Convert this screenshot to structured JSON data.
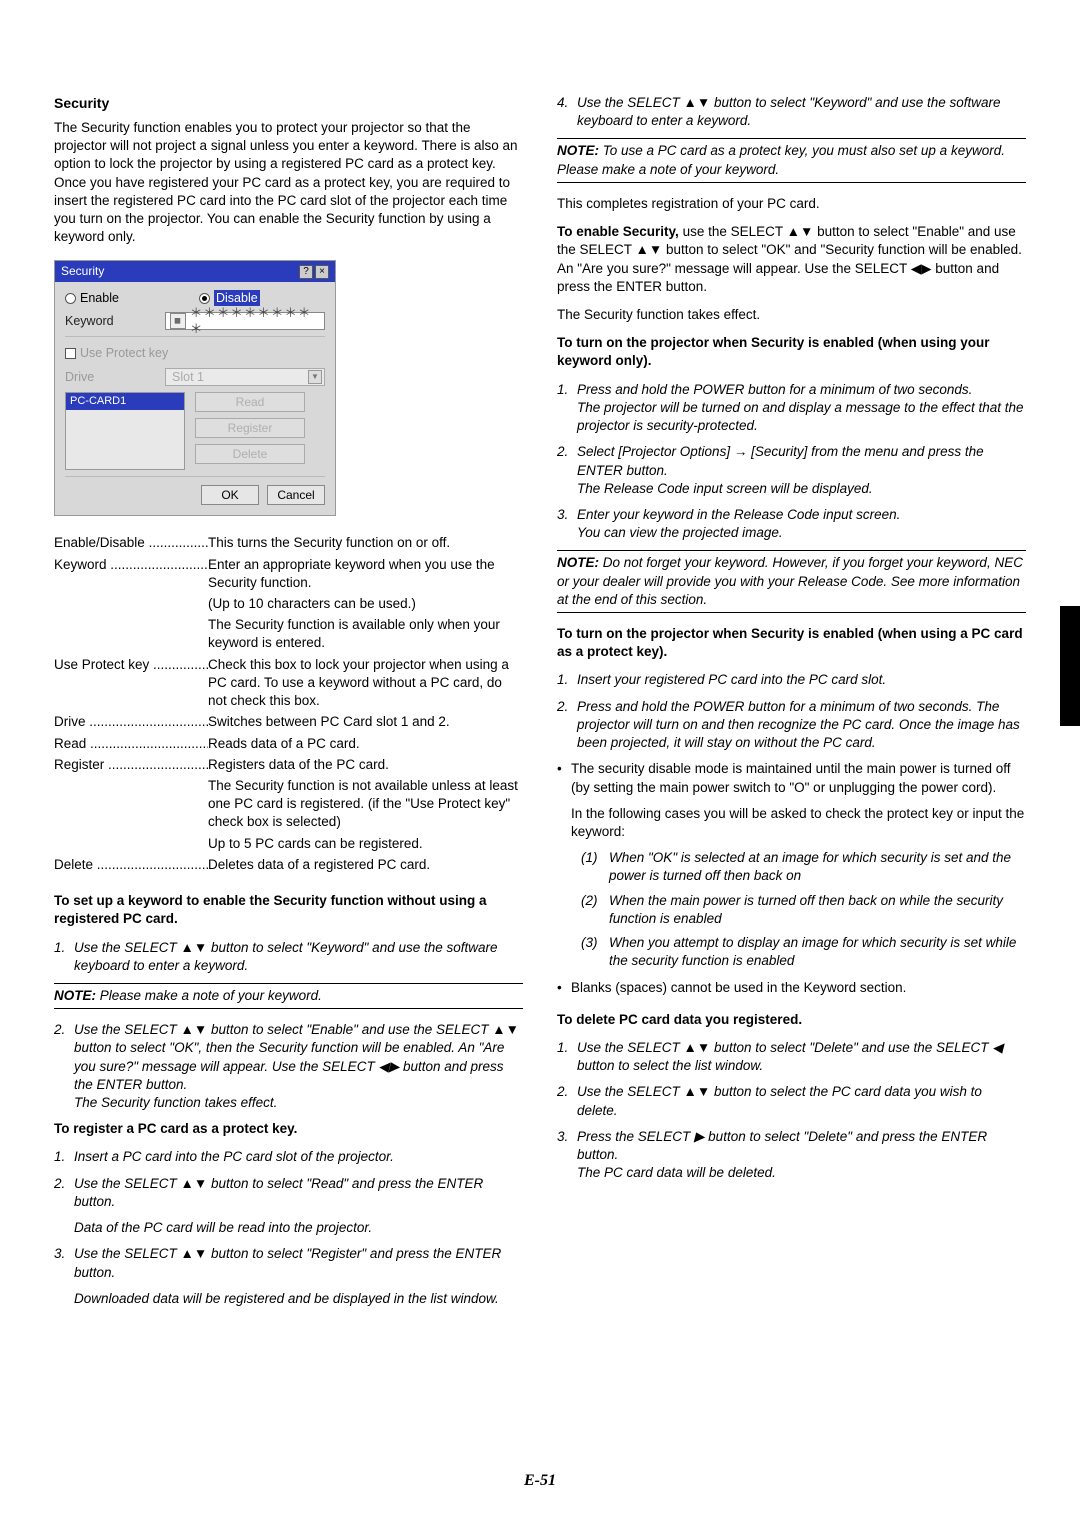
{
  "heading": "Security",
  "intro": "The Security function enables you to protect your projector so that the projector will not project a signal unless you enter a keyword. There is also an option to lock the projector by using a registered PC card as a protect key. Once you have registered your PC card as a protect key, you are required to insert the registered PC card into the PC card slot of the projector each time you turn on the projector. You can enable the Security function by using a keyword only.",
  "dialog": {
    "title": "Security",
    "enable": "Enable",
    "disable": "Disable",
    "keyword_label": "Keyword",
    "keyword_value": "＊＊＊＊＊＊＊＊＊＊",
    "use_protect_key": "Use Protect key",
    "drive_label": "Drive",
    "slot": "Slot 1",
    "list_item": "PC-CARD1",
    "btn_read": "Read",
    "btn_register": "Register",
    "btn_delete": "Delete",
    "btn_ok": "OK",
    "btn_cancel": "Cancel"
  },
  "defs": {
    "enable_disable": {
      "t": "Enable/Disable",
      "d": "This turns the Security function on or off."
    },
    "keyword": {
      "t": "Keyword",
      "d1": "Enter an appropriate keyword when you use the Security function.",
      "d2": "(Up to 10 characters can be used.)",
      "d3": "The Security function is available only when your keyword is entered."
    },
    "upk": {
      "t": "Use Protect key",
      "d": "Check this box to lock your projector when using a PC card. To use a keyword without a PC card, do not check this box."
    },
    "drive": {
      "t": "Drive",
      "d": "Switches between PC Card slot 1 and 2."
    },
    "read": {
      "t": "Read",
      "d": "Reads data of a PC card."
    },
    "register": {
      "t": "Register",
      "d1": "Registers data of the PC card.",
      "d2": "The Security function is not available unless at least one PC card is registered. (if the \"Use Protect key\" check box is selected)",
      "d3": "Up to 5 PC cards can be registered."
    },
    "delete": {
      "t": "Delete",
      "d": "Deletes data of a registered PC card."
    }
  },
  "setup_heading": "To set up a keyword to enable the Security function without using a registered PC card.",
  "setup_1": "Use the SELECT ▲▼ button to select \"Keyword\" and use the software keyboard to enter a keyword.",
  "note1": "NOTE: Please make a note of your keyword.",
  "setup_2": "Use the SELECT ▲▼ button to select \"Enable\" and use the SELECT ▲▼ button to select \"OK\", then the Security function will be enabled. An \"Are you sure?\" message will appear. Use the SELECT ◀▶ button and press the ENTER button.",
  "setup_2b": "The Security function takes effect.",
  "reg_heading": "To register a PC card as a protect key.",
  "reg_1": "Insert a PC card into the PC card slot of the projector.",
  "reg_2": "Use the SELECT ▲▼ button to select \"Read\" and press the ENTER button.",
  "reg_2b": "Data of the PC card will be read into the projector.",
  "reg_3": "Use the SELECT ▲▼ button to select \"Register\" and press the ENTER button.",
  "reg_3b": "Downloaded data will be registered and be displayed in the list window.",
  "reg_4": "Use the SELECT ▲▼ button to select \"Keyword\" and use the software keyboard to enter a keyword.",
  "note_pc": "NOTE: To use a PC card as a protect key, you must also set up a keyword. Please make a note of your keyword.",
  "complete": "This completes registration of your PC card.",
  "enable_sec": "To enable Security, use the SELECT ▲▼ button to select \"Enable\" and use the SELECT ▲▼ button to select \"OK\" and \"Security function will be enabled. An \"Are you sure?\" message will appear. Use the SELECT ◀▶ button and press the ENTER button.",
  "enable_sec_b": "The Security function takes effect.",
  "turn_on_kw_h": "To turn on the projector when Security is enabled (when using your keyword only).",
  "ton_1": "Press and hold the POWER button for a minimum of two seconds.",
  "ton_1b": "The projector will be turned on and display a message to the effect that the projector is security-protected.",
  "ton_2": "Select [Projector Options] → [Security] from the menu and press the ENTER button.",
  "ton_2b": "The Release Code input screen will be displayed.",
  "ton_3": "Enter your keyword in the Release Code input screen.",
  "ton_3b": "You can view the projected image.",
  "note_forget": "NOTE: Do not forget your keyword. However, if you forget your keyword, NEC or your dealer will provide you with your Release Code. See more information at the end of this section.",
  "turn_on_pc_h": "To turn on the projector when Security is enabled (when using a PC card as a protect key).",
  "tpc_1": "Insert your registered PC card into the PC card slot.",
  "tpc_2": "Press and hold the POWER button for a minimum of two seconds. The projector will turn on and then recognize the PC card. Once the image has been projected, it will stay on without the PC card.",
  "bullet_disable": "The security disable mode is maintained until the main power is turned off (by setting the main power switch to \"O\" or unplugging the power cord).",
  "bullet_cases_intro": "In the following cases you will be asked to check the protect key or input the keyword:",
  "case1": "When \"OK\" is selected at an image for which security is set and the power is turned off then back on",
  "case2": "When the main power is turned off then back on while the security function is enabled",
  "case3": "When you attempt to display an image for which security is set while the security function is enabled",
  "bullet_blanks": "Blanks (spaces) cannot be used in the Keyword section.",
  "del_h": "To delete PC card data you registered.",
  "del_1": "Use the SELECT ▲▼ button to select \"Delete\" and use the SELECT ◀ button to select the list window.",
  "del_2": "Use the SELECT ▲▼ button to select the PC card data you wish to delete.",
  "del_3": "Press the SELECT ▶ button to select \"Delete\" and press the ENTER button.",
  "del_3b": "The PC card data will be deleted.",
  "page_num": "E-51",
  "note_label": "NOTE:"
}
